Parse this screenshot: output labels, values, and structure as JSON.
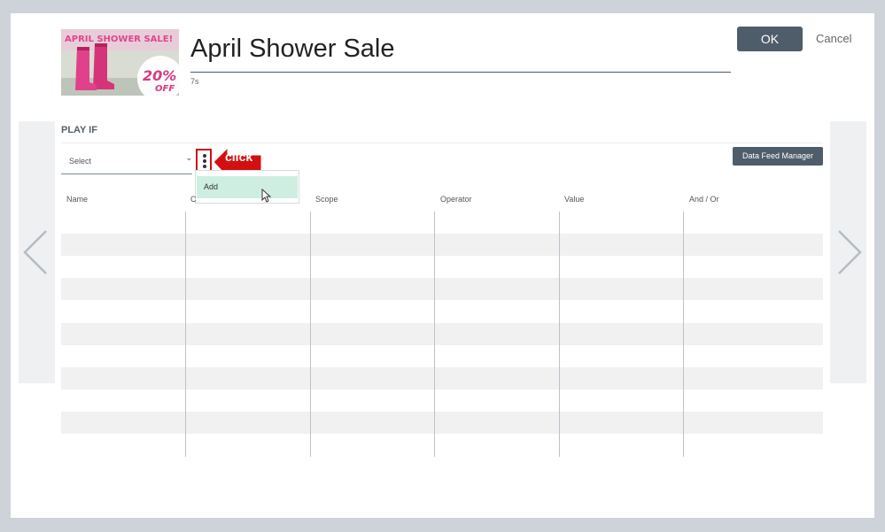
{
  "dialog": {
    "thumbnail": {
      "banner_text": "APRIL SHOWER SALE!",
      "badge_percent": "20%",
      "badge_off": "OFF"
    },
    "title": "April Shower Sale",
    "duration": "7s",
    "ok_label": "OK",
    "cancel_label": "Cancel"
  },
  "play_if": {
    "section_label": "PLAY IF",
    "select": {
      "value": "Select"
    },
    "menu": {
      "items": [
        {
          "label": "Add"
        }
      ]
    },
    "annotation": {
      "label": "click",
      "color": "#d40f0f"
    },
    "data_feed_button": "Data Feed Manager",
    "table": {
      "columns": [
        "Name",
        "C",
        "Scope",
        "Operator",
        "Value",
        "And / Or"
      ],
      "rows": []
    }
  },
  "colors": {
    "primary_button": "#4f5d6b",
    "menu_highlight": "#cfeee2",
    "overlay": "#cdd3d8"
  }
}
